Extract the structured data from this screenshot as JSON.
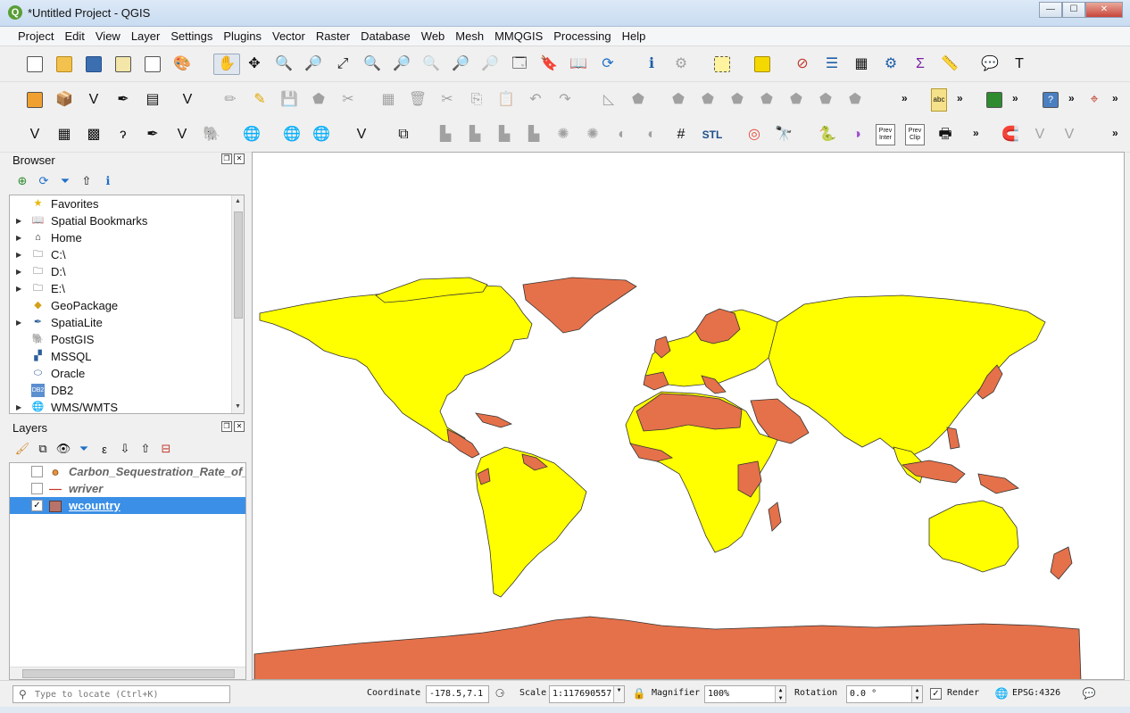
{
  "window": {
    "title": "*Untitled Project - QGIS",
    "app_icon": "Q",
    "controls": {
      "minimize": "—",
      "maximize": "☐",
      "close": "✕"
    }
  },
  "menubar": [
    "Project",
    "Edit",
    "View",
    "Layer",
    "Settings",
    "Plugins",
    "Vector",
    "Raster",
    "Database",
    "Web",
    "Mesh",
    "MMQGIS",
    "Processing",
    "Help"
  ],
  "toolbar": {
    "more": "»",
    "label_abc": "abc",
    "stl_label": "STL",
    "prev_inter": "Prev Inter",
    "prev_clip": "Prev Clip"
  },
  "browser": {
    "title": "Browser",
    "items": [
      {
        "label": "Favorites",
        "icon": "star-icon",
        "expandable": false
      },
      {
        "label": "Spatial Bookmarks",
        "icon": "bookmarks-icon",
        "expandable": true
      },
      {
        "label": "Home",
        "icon": "home-icon",
        "expandable": true
      },
      {
        "label": "C:\\",
        "icon": "folder-icon",
        "expandable": true
      },
      {
        "label": "D:\\",
        "icon": "folder-icon",
        "expandable": true
      },
      {
        "label": "E:\\",
        "icon": "folder-icon",
        "expandable": true
      },
      {
        "label": "GeoPackage",
        "icon": "geopackage-icon",
        "expandable": false
      },
      {
        "label": "SpatiaLite",
        "icon": "spatialite-icon",
        "expandable": true
      },
      {
        "label": "PostGIS",
        "icon": "postgis-icon",
        "expandable": false
      },
      {
        "label": "MSSQL",
        "icon": "mssql-icon",
        "expandable": false
      },
      {
        "label": "Oracle",
        "icon": "oracle-icon",
        "expandable": false
      },
      {
        "label": "DB2",
        "icon": "db2-icon",
        "expandable": false
      },
      {
        "label": "WMS/WMTS",
        "icon": "wms-icon",
        "expandable": true
      }
    ]
  },
  "layers": {
    "title": "Layers",
    "items": [
      {
        "label": "Carbon_Sequestration_Rate_of_",
        "checked": false,
        "symbol": "point",
        "color": "#e8913a"
      },
      {
        "label": "wriver",
        "checked": false,
        "symbol": "line",
        "color": "#c0392b"
      },
      {
        "label": "wcountry",
        "checked": true,
        "symbol": "polygon",
        "color": "#b8736a"
      }
    ]
  },
  "map": {
    "land_fill": "#ffff00",
    "highlight_fill": "#e5714a",
    "outline": "#333333"
  },
  "statusbar": {
    "locator_placeholder": "Type to locate (Ctrl+K)",
    "coordinate_label": "Coordinate",
    "coordinate_value": "-178.5,7.1",
    "scale_label": "Scale",
    "scale_value": "1:117690557",
    "magnifier_label": "Magnifier",
    "magnifier_value": "100%",
    "rotation_label": "Rotation",
    "rotation_value": "0.0 °",
    "render_label": "Render",
    "render_checked": true,
    "crs": "EPSG:4326"
  }
}
